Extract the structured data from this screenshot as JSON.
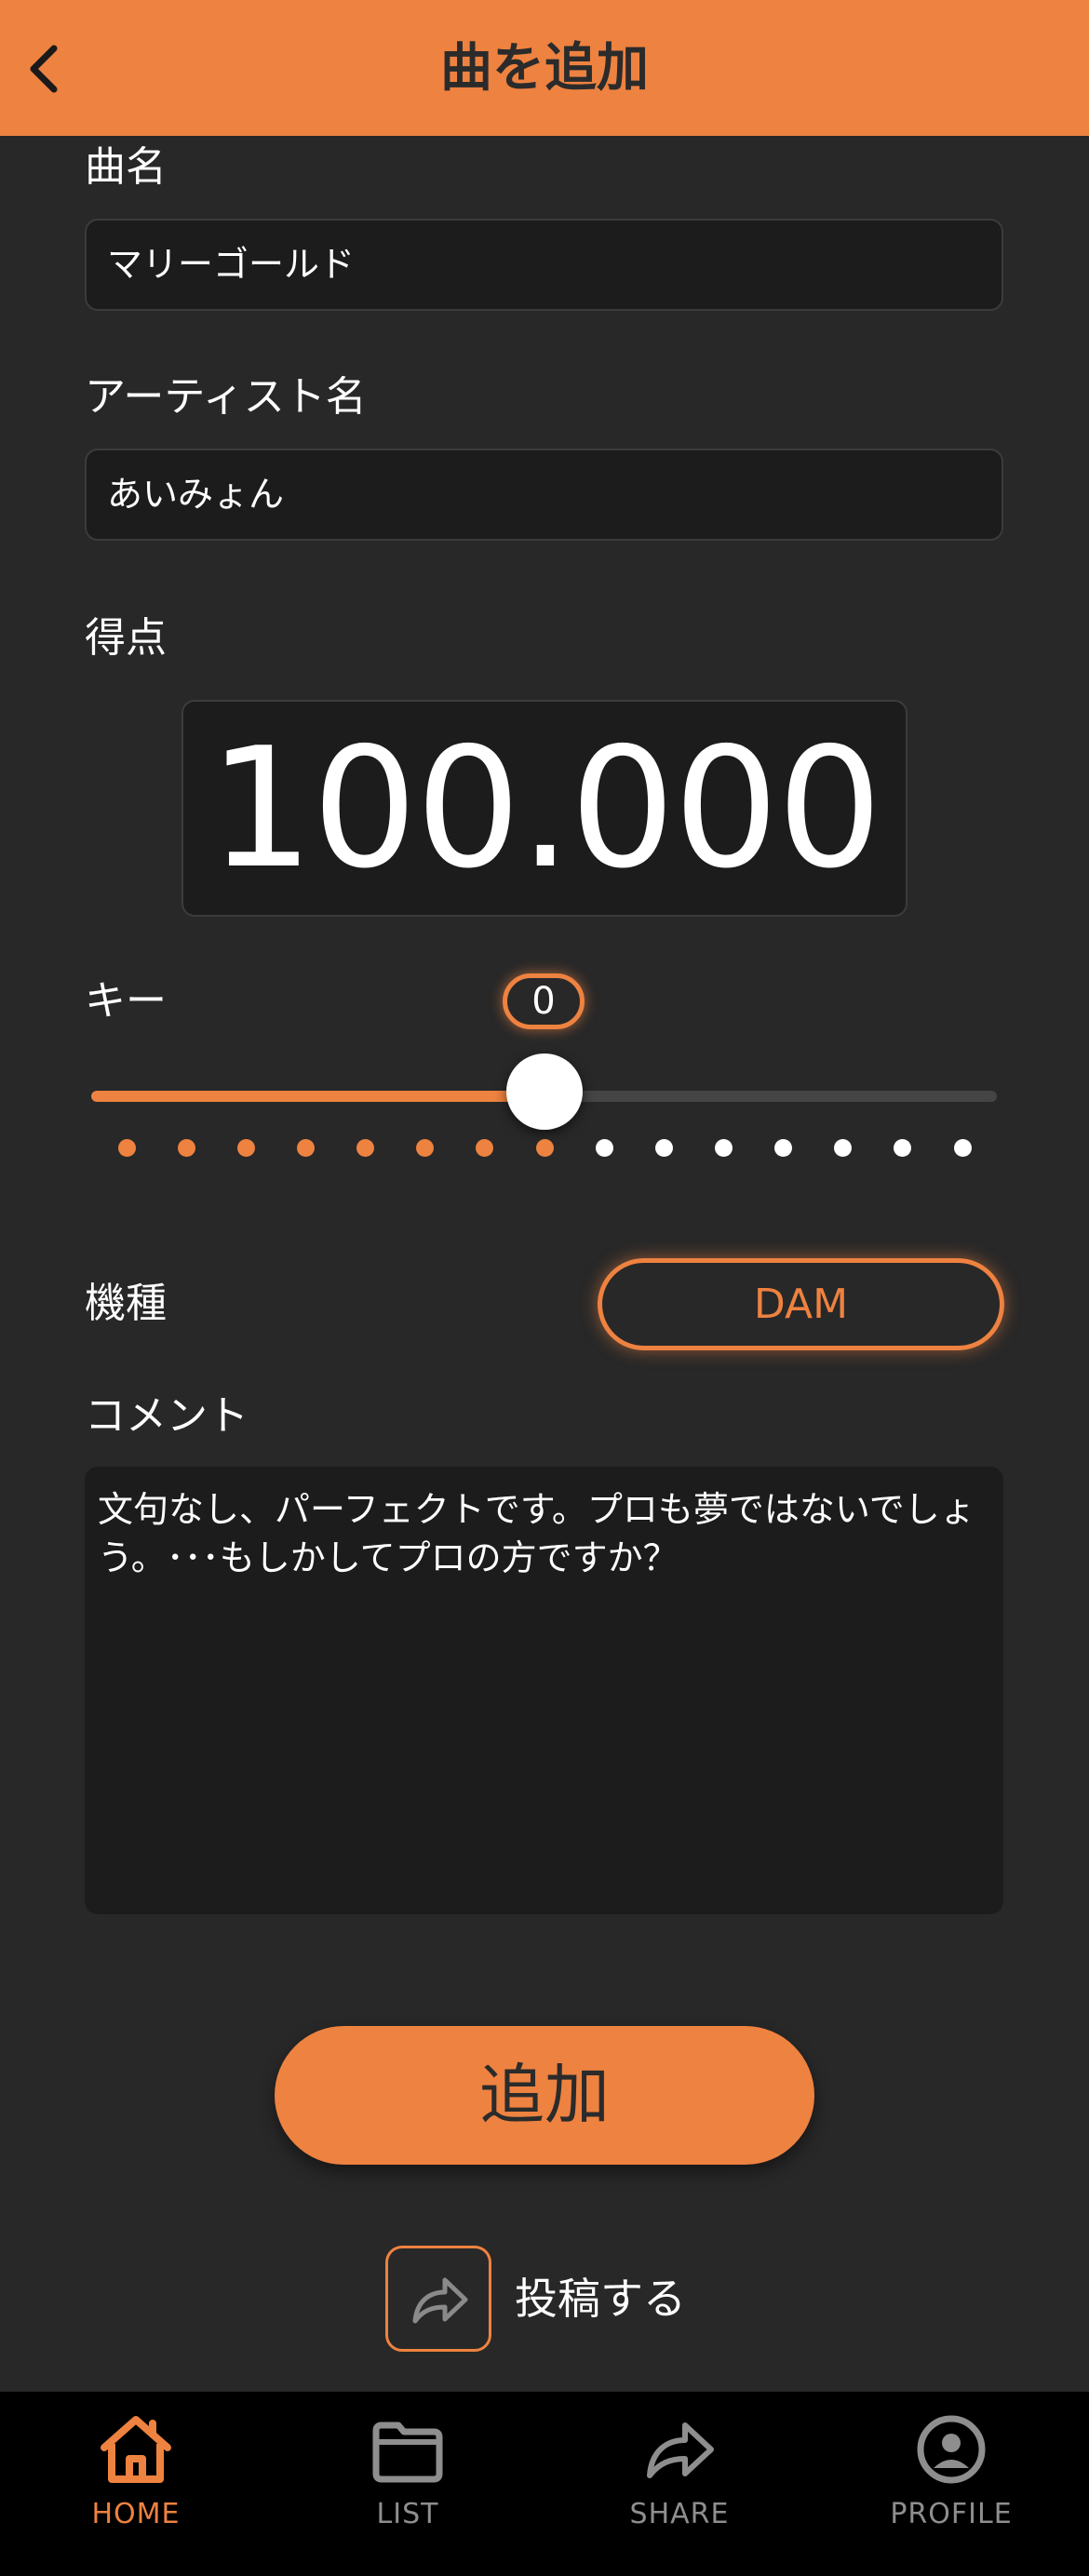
{
  "header": {
    "title": "曲を追加"
  },
  "form": {
    "song_label": "曲名",
    "song_value": "マリーゴールド",
    "artist_label": "アーティスト名",
    "artist_value": "あいみょん",
    "score_label": "得点",
    "score_value": "100.000",
    "key_label": "キー",
    "key_value": "0",
    "key_slider": {
      "min": -7,
      "max": 7,
      "value": 0
    },
    "model_label": "機種",
    "model_value": "DAM",
    "comment_label": "コメント",
    "comment_value": "文句なし、パーフェクトです。プロも夢ではないでしょう。･･･もしかしてプロの方ですか？"
  },
  "actions": {
    "add_label": "追加",
    "post_label": "投稿する"
  },
  "tabs": [
    {
      "label": "HOME",
      "icon": "house-icon",
      "active": true
    },
    {
      "label": "LIST",
      "icon": "folder-icon",
      "active": false
    },
    {
      "label": "SHARE",
      "icon": "share-arrow-icon",
      "active": false
    },
    {
      "label": "PROFILE",
      "icon": "person-circle-icon",
      "active": false
    }
  ],
  "colors": {
    "accent": "#ee8240",
    "background": "#282828",
    "field": "#1c1c1c",
    "tabbar": "#000000",
    "inactive_tab": "#8e8e8e"
  }
}
